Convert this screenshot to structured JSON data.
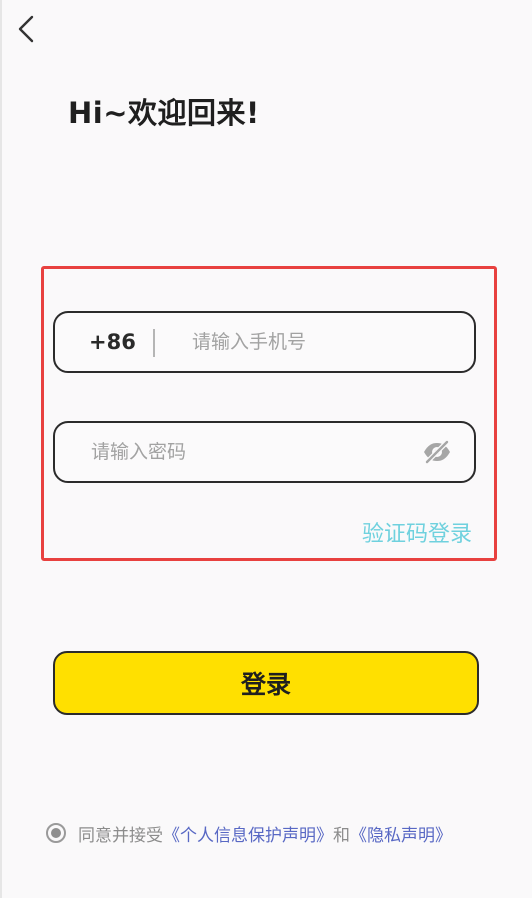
{
  "header": {
    "back_icon": "chevron-left-icon",
    "title": "Hi~欢迎回来!"
  },
  "form": {
    "country_code": "+86",
    "phone_placeholder": "请输入手机号",
    "password_placeholder": "请输入密码",
    "password_toggle_icon": "eye-off-icon",
    "sms_login_label": "验证码登录"
  },
  "login_button": {
    "label": "登录"
  },
  "agreement": {
    "checked": true,
    "prefix": "同意并接受",
    "link_personal_info": "《个人信息保护声明》",
    "and": "和",
    "link_privacy": "《隐私声明》"
  },
  "colors": {
    "primary_yellow": "#ffe000",
    "sms_link": "#6fd1de",
    "agreement_link": "#5868c4",
    "highlight_border": "#e8413f"
  }
}
